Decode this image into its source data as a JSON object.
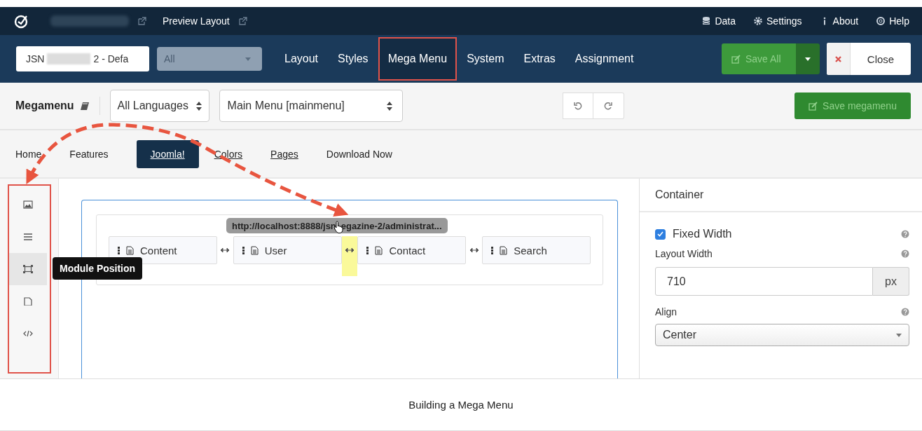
{
  "top_bar": {
    "preview_link": "Preview Layout",
    "links": [
      {
        "kind": "data",
        "label": "Data"
      },
      {
        "kind": "settings",
        "label": "Settings"
      },
      {
        "kind": "about",
        "label": "About"
      },
      {
        "kind": "help",
        "label": "Help"
      }
    ]
  },
  "nav_bar": {
    "template_prefix": "JSN",
    "template_suffix": "2 - Defa",
    "filter": "All",
    "tabs": [
      {
        "label": "Layout",
        "selected": false
      },
      {
        "label": "Styles",
        "selected": false
      },
      {
        "label": "Mega Menu",
        "selected": true
      },
      {
        "label": "System",
        "selected": false
      },
      {
        "label": "Extras",
        "selected": false
      },
      {
        "label": "Assignment",
        "selected": false
      }
    ],
    "save_button": "Save All",
    "close_button": "Close"
  },
  "toolbar": {
    "title": "Megamenu",
    "language": "All Languages",
    "menu": "Main Menu [mainmenu]",
    "save_button": "Save megamenu"
  },
  "menu_items": [
    {
      "label": "Home",
      "selected": false,
      "underlined": false
    },
    {
      "label": "Features",
      "selected": false,
      "underlined": false
    },
    {
      "label": "Joomla!",
      "selected": true,
      "underlined": true
    },
    {
      "label": "Colors",
      "selected": false,
      "underlined": true
    },
    {
      "label": "Pages",
      "selected": false,
      "underlined": true
    },
    {
      "label": "Download Now",
      "selected": false,
      "underlined": false
    }
  ],
  "tools": [
    {
      "kind": "image",
      "hovered": false
    },
    {
      "kind": "list",
      "hovered": false
    },
    {
      "kind": "module",
      "hovered": true
    },
    {
      "kind": "page",
      "hovered": false
    },
    {
      "kind": "code",
      "hovered": false
    }
  ],
  "tooltip": "Module Position",
  "canvas": {
    "url_parts": [
      "http://localhost:8888/jsn",
      "egazine-2/administrat..."
    ],
    "modules": [
      {
        "label": "Content",
        "drop_before": false
      },
      {
        "label": "User",
        "drop_before": false
      },
      {
        "label": "Contact",
        "drop_before": true
      },
      {
        "label": "Search",
        "drop_before": false
      }
    ]
  },
  "panel": {
    "title": "Container",
    "fixed_width": {
      "label": "Fixed Width",
      "checked": true
    },
    "layout_width": {
      "label": "Layout Width",
      "value": "710",
      "unit": "px"
    },
    "align": {
      "label": "Align",
      "value": "Center"
    }
  },
  "caption": "Building a Mega Menu"
}
